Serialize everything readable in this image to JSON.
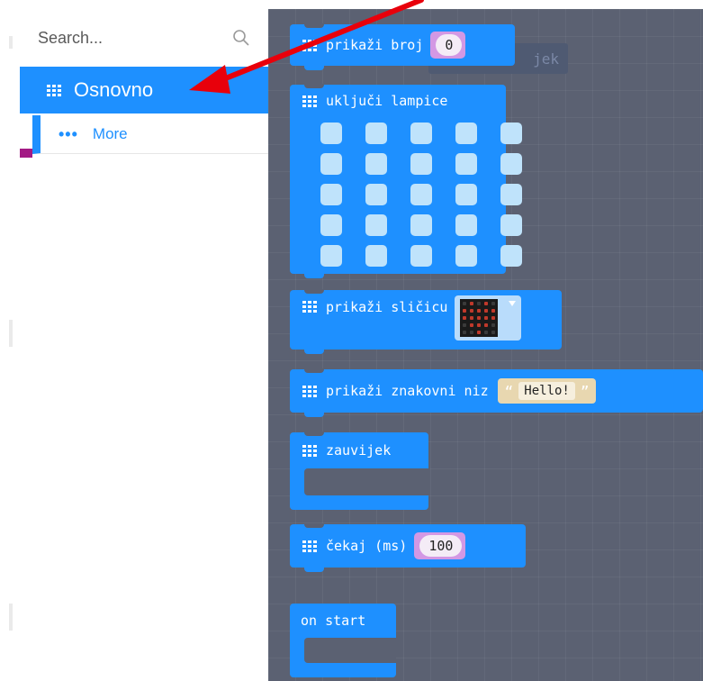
{
  "toolbox": {
    "search_placeholder": "Search...",
    "categories": [
      {
        "label": "Osnovno",
        "icon": "grid-icon",
        "color": "#1e90ff",
        "selected": true
      },
      {
        "label": "More",
        "icon": "more-dots-icon",
        "color": "#1e90ff"
      }
    ]
  },
  "flyout": {
    "background_color": "#5b6172",
    "ghost_block_text": "jek",
    "blocks": {
      "show_number": {
        "label": "prikaži broj",
        "value": "0"
      },
      "show_leds": {
        "label": "uključi lampice"
      },
      "show_icon": {
        "label": "prikaži sličicu"
      },
      "show_string": {
        "label": "prikaži znakovni niz",
        "open_quote": "“",
        "close_quote": "”",
        "value": "Hello!"
      },
      "forever": {
        "label": "zauvijek"
      },
      "pause": {
        "label": "čekaj (ms)",
        "value": "100"
      },
      "on_start": {
        "label": "on start"
      }
    },
    "block_color": "#1e90ff"
  },
  "annotation": {
    "type": "arrow",
    "color": "#e8000b",
    "points_to": "Osnovno"
  }
}
